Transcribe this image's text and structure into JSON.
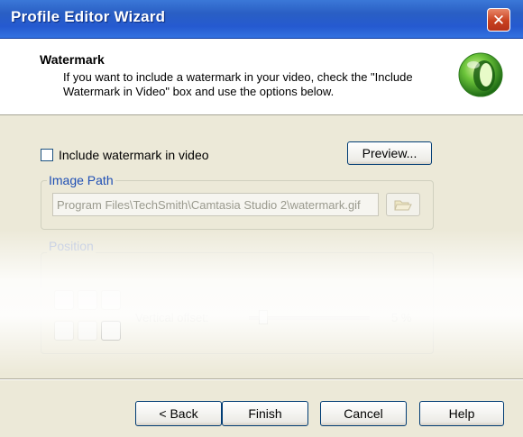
{
  "window": {
    "title": "Profile Editor Wizard",
    "close_label": "✕"
  },
  "header": {
    "title": "Watermark",
    "description": "If you want to include a watermark in your video, check the \"Include Watermark in Video\" box and use the options below."
  },
  "watermark": {
    "include_label": "Include watermark in video",
    "include_checked": false,
    "preview_label": "Preview..."
  },
  "image_path": {
    "label": "Image Path",
    "value": "Program Files\\TechSmith\\Camtasia Studio 2\\watermark.gif",
    "browse_icon": "folder-open-icon"
  },
  "position": {
    "label": "Position",
    "vertical_offset_label": "Vertical offset:",
    "vertical_offset_value": "5 %",
    "vertical_offset_percent": 5
  },
  "footer": {
    "back_label": "< Back",
    "finish_label": "Finish",
    "cancel_label": "Cancel",
    "help_label": "Help"
  },
  "colors": {
    "titlebar": "#2a5fc4",
    "dialog_bg": "#ece9d8",
    "group_label": "#1f4fb5",
    "logo_green": "#3ea32a"
  }
}
